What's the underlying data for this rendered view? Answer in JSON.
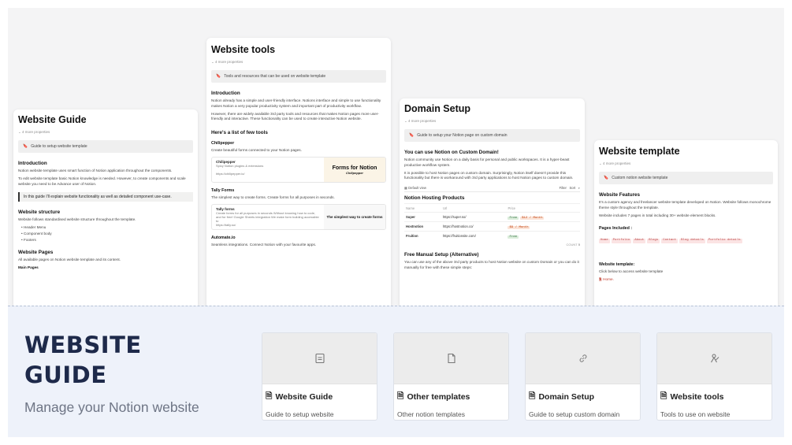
{
  "docs": {
    "guide": {
      "title": "Website Guide",
      "props": "4 more properties",
      "callout": "Guide to setup website template",
      "intro_h": "Introduction",
      "intro_p1": "Notion website template uses smart function of Notion application throughout the components.",
      "intro_p2": "To edit website template basic Notion knowledge is needed. However, to create components and scale website you need to be Advance user of Notion.",
      "quote": "In this guide I'll explain website functionality as well as detailed component use-case.",
      "structure_h": "Website structure",
      "structure_p": "Website follows standardised website structure throughout the template.",
      "bullets": [
        "Header Menu",
        "Component body",
        "Footers"
      ],
      "pages_h": "Website Pages",
      "pages_p": "All available pages on Notion website template and its content.",
      "main_pages": "Main Pages"
    },
    "tools": {
      "title": "Website tools",
      "props": "4 more properties",
      "callout": "Tools and resources that can be used on website template",
      "intro_h": "Introduction",
      "intro_p1": "Notion already has a simple and user-friendly interface. Notions interface and simple to use functionality makes Notion a very popular productivity system and important part of productivity workflow.",
      "intro_p2": "However, there are widely available 3rd party tools and resources that makes Notion pages more user-friendly and interactive. These functionality can be used to create interactive Notion website.",
      "list_h": "Here's a list of few tools",
      "chili_h": "Chilipepper",
      "chili_p": "Create beautiful forms connected to your Notion pages.",
      "chili_name": "Chilipepper",
      "chili_desc": "Spicy Notion plugins & extensions",
      "chili_url": "https://chilipepper.io/",
      "chili_banner": "Forms for Notion",
      "chili_brand": "Chilipepper",
      "tally_h": "Tally Forms",
      "tally_p": "The simplest way to create forms. Create forms for all purposes in seconds.",
      "tally_name": "Tally forms",
      "tally_desc": "Create forms for all purposes in seconds Without knowing how to code, and for free! Google Sheets integration We make form building accessible to",
      "tally_url": "https://tally.so/",
      "tally_banner": "The simplest way to create forms",
      "auto_h": "Automate.io",
      "auto_p": "Seamless integrations. Connect Notion with your favourite apps."
    },
    "domain": {
      "title": "Domain Setup",
      "props": "4 more properties",
      "callout": "Guide to setup your Notion page on custom domain",
      "can_h": "You can use Notion on Custom Domain!",
      "can_p1": "Notion community use Notion on a daily basis for personal and public workspaces. It is a hyper-beast productive workflow system.",
      "can_p2": "It is possible to host Notion pages on custom domain. Surprisingly, Notion itself doesn't provide this functionality but there is workaround with 3rd party applications to host Notion pages to custom domain.",
      "view": "Default view",
      "filter": "Filter",
      "sort": "Sort",
      "db_title": "Notion Hosting Products",
      "col_name": "Name",
      "col_url": "Url",
      "col_price": "Price",
      "rows": [
        {
          "name": "Super",
          "url": "https://super.so/",
          "tag1": "Free",
          "tag2": "$12 / Month"
        },
        {
          "name": "Hostnotion",
          "url": "https://hostnotion.co/",
          "tag1": "",
          "tag2": "$9 / Month"
        },
        {
          "name": "Fruition",
          "url": "https://fruitionsite.com/",
          "tag1": "Free",
          "tag2": ""
        }
      ],
      "count_label": "COUNT",
      "count": "5",
      "free_h": "Free Manual Setup (Alternative)",
      "free_p": "You can use any of the above 3rd party products to host Notion website on custom Domain or you can do it manually for free with these simple steps:"
    },
    "template": {
      "title": "Website template",
      "props": "4 more properties",
      "callout": "Custom notion website template",
      "feat_h": "Website Features",
      "feat_p1": "It's a custom agency and freelancer website template developed on Notion. Website follows monochrome theme style throughout the template.",
      "feat_p2": "Website includes 7 pages in total including 30+ website element blocks.",
      "pages_h": "Pages Included :",
      "pages": [
        "Home",
        "Portfolio",
        "About",
        "Blogs",
        "Contact",
        "Blog details",
        "Portfolio details"
      ],
      "tpl_h": "Website template:",
      "tpl_p": "Click below to access website template",
      "home_link": "Home."
    }
  },
  "hero": {
    "title_line1": "WEBSITE",
    "title_line2": "GUIDE",
    "subtitle": "Manage your Notion website"
  },
  "cards": [
    {
      "title": "Website Guide",
      "desc": "Guide to setup website",
      "icon": "book-icon"
    },
    {
      "title": "Other templates",
      "desc": "Other notion templates",
      "icon": "file-icon"
    },
    {
      "title": "Domain Setup",
      "desc": "Guide to setup custom domain",
      "icon": "link-icon"
    },
    {
      "title": "Website tools",
      "desc": "Tools to use on website",
      "icon": "tools-icon"
    }
  ]
}
